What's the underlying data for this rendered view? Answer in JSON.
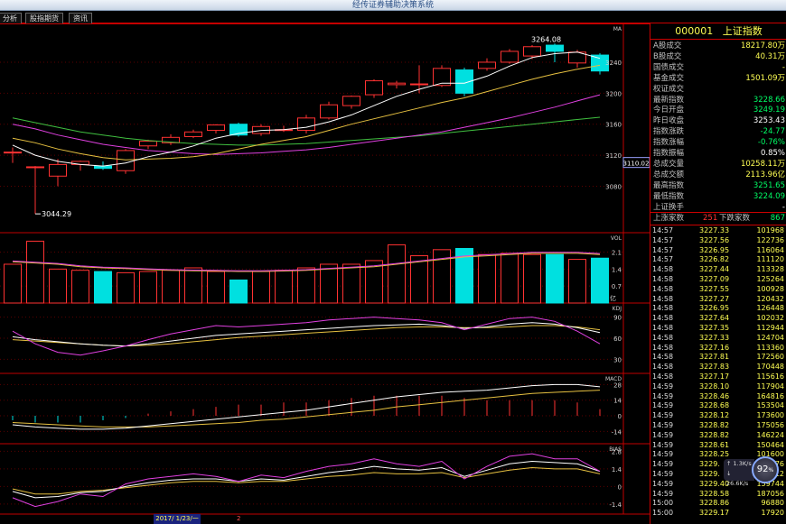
{
  "window": {
    "title": "经传证券辅助决策系统"
  },
  "tabs": [
    {
      "label": "分析"
    },
    {
      "label": "股指期货"
    },
    {
      "label": "资讯"
    }
  ],
  "colors": {
    "up": "#ff3232",
    "down": "#00e0e0",
    "price": "#ffff54",
    "ma5": "#ffffff",
    "ma10": "#e6c040",
    "ma20": "#e040e0",
    "ma60": "#40c040",
    "grid": "#c00000"
  },
  "main_chart": {
    "label_tr": "MA",
    "y_ticks": [
      "3240",
      "3200",
      "3160",
      "3120",
      "3080"
    ],
    "current_price_box": "3110.02",
    "annot_high": "3264.08",
    "annot_low": "3044.29"
  },
  "volume_panel": {
    "label": "VOL",
    "y_ticks": [
      "2.1",
      "1.4",
      "0.7"
    ],
    "unit": "亿"
  },
  "kdj_panel": {
    "label": "KDJ",
    "y_ticks": [
      "90",
      "60",
      "30"
    ]
  },
  "macd_panel": {
    "label": "MACD",
    "y_ticks": [
      "28",
      "14",
      "0",
      "-14"
    ]
  },
  "bias_panel": {
    "label": "BIAS",
    "y_ticks": [
      "2.8",
      "1.4",
      "0",
      "-1.4"
    ]
  },
  "bottom": {
    "date": "2017/ 1/23/一",
    "page": "2"
  },
  "chart_data": {
    "type": "candlestick",
    "candles": [
      {
        "o": 3123,
        "h": 3130,
        "l": 3110,
        "c": 3124
      },
      {
        "o": 3105,
        "h": 3106,
        "l": 3044.29,
        "c": 3105
      },
      {
        "o": 3093,
        "h": 3115,
        "l": 3080,
        "c": 3108
      },
      {
        "o": 3108,
        "h": 3113,
        "l": 3100,
        "c": 3112
      },
      {
        "o": 3106,
        "h": 3112,
        "l": 3101,
        "c": 3103
      },
      {
        "o": 3100,
        "h": 3128,
        "l": 3096,
        "c": 3126
      },
      {
        "o": 3132,
        "h": 3140,
        "l": 3128,
        "c": 3138
      },
      {
        "o": 3136,
        "h": 3147,
        "l": 3133,
        "c": 3143
      },
      {
        "o": 3144,
        "h": 3153,
        "l": 3142,
        "c": 3150
      },
      {
        "o": 3152,
        "h": 3160,
        "l": 3148,
        "c": 3159
      },
      {
        "o": 3160,
        "h": 3162,
        "l": 3144,
        "c": 3146
      },
      {
        "o": 3148,
        "h": 3160,
        "l": 3145,
        "c": 3157
      },
      {
        "o": 3153,
        "h": 3158,
        "l": 3150,
        "c": 3153
      },
      {
        "o": 3152,
        "h": 3172,
        "l": 3148,
        "c": 3168
      },
      {
        "o": 3168,
        "h": 3189,
        "l": 3166,
        "c": 3185
      },
      {
        "o": 3184,
        "h": 3197,
        "l": 3180,
        "c": 3196
      },
      {
        "o": 3198,
        "h": 3218,
        "l": 3194,
        "c": 3216
      },
      {
        "o": 3211,
        "h": 3216,
        "l": 3206,
        "c": 3213
      },
      {
        "o": 3212,
        "h": 3236,
        "l": 3200,
        "c": 3212
      },
      {
        "o": 3210,
        "h": 3236,
        "l": 3208,
        "c": 3232
      },
      {
        "o": 3230,
        "h": 3233,
        "l": 3196,
        "c": 3200
      },
      {
        "o": 3232,
        "h": 3245,
        "l": 3229,
        "c": 3240
      },
      {
        "o": 3240,
        "h": 3257,
        "l": 3238,
        "c": 3254
      },
      {
        "o": 3248,
        "h": 3262,
        "l": 3244,
        "c": 3260
      },
      {
        "o": 3262,
        "h": 3264.08,
        "l": 3240,
        "c": 3254
      },
      {
        "o": 3239,
        "h": 3256,
        "l": 3233,
        "c": 3253
      },
      {
        "o": 3249.19,
        "h": 3251.65,
        "l": 3224.09,
        "c": 3228.66
      }
    ],
    "ma5": [
      3133,
      3120,
      3112,
      3108,
      3106,
      3110,
      3118,
      3124,
      3132,
      3142,
      3148,
      3152,
      3153,
      3156,
      3163,
      3172,
      3184,
      3196,
      3205,
      3213,
      3213,
      3222,
      3235,
      3246,
      3251,
      3253,
      3245
    ],
    "ma10": [
      3142,
      3136,
      3128,
      3122,
      3117,
      3114,
      3115,
      3116,
      3118,
      3122,
      3128,
      3134,
      3139,
      3144,
      3152,
      3160,
      3167,
      3174,
      3181,
      3188,
      3194,
      3202,
      3210,
      3218,
      3225,
      3231,
      3236
    ],
    "ma20": [
      3160,
      3154,
      3146,
      3140,
      3134,
      3130,
      3126,
      3124,
      3122,
      3121,
      3122,
      3123,
      3125,
      3127,
      3130,
      3134,
      3138,
      3142,
      3146,
      3150,
      3156,
      3162,
      3168,
      3175,
      3182,
      3190,
      3198
    ],
    "ma60": [
      3168,
      3162,
      3156,
      3150,
      3146,
      3142,
      3139,
      3137,
      3135,
      3134,
      3133,
      3133,
      3134,
      3135,
      3137,
      3139,
      3141,
      3143,
      3145,
      3148,
      3151,
      3154,
      3157,
      3160,
      3163,
      3166,
      3169
    ],
    "volume": [
      1.6,
      2.55,
      1.4,
      1.35,
      1.3,
      1.25,
      1.3,
      1.35,
      1.45,
      1.3,
      0.95,
      1.3,
      1.35,
      1.45,
      1.6,
      1.6,
      1.75,
      2.4,
      1.95,
      2.2,
      2.25,
      2.0,
      2.05,
      2.0,
      2.0,
      1.8,
      1.85
    ],
    "vol_ma": [
      1.7,
      1.65,
      1.6,
      1.5,
      1.45,
      1.42,
      1.38,
      1.35,
      1.33,
      1.32,
      1.3,
      1.3,
      1.32,
      1.35,
      1.4,
      1.45,
      1.5,
      1.6,
      1.7,
      1.8,
      1.9,
      1.95,
      2.0,
      2.05,
      2.05,
      2.05,
      2.0
    ],
    "kdj_k": [
      62,
      58,
      55,
      52,
      50,
      49,
      52,
      56,
      60,
      64,
      66,
      68,
      70,
      72,
      74,
      76,
      78,
      79,
      80,
      78,
      74,
      76,
      80,
      82,
      80,
      75,
      68
    ],
    "kdj_d": [
      58,
      56,
      54,
      52,
      50,
      49,
      50,
      52,
      55,
      58,
      61,
      63,
      65,
      67,
      69,
      71,
      73,
      75,
      76,
      76,
      75,
      75,
      76,
      78,
      78,
      76,
      72
    ],
    "kdj_j": [
      70,
      52,
      40,
      36,
      42,
      49,
      58,
      66,
      72,
      78,
      76,
      78,
      80,
      82,
      86,
      88,
      90,
      88,
      86,
      82,
      72,
      80,
      88,
      90,
      84,
      70,
      52
    ],
    "macd_dif": [
      -8,
      -10,
      -11,
      -12,
      -12,
      -11,
      -9,
      -7,
      -5,
      -3,
      -1,
      1,
      3,
      5,
      8,
      11,
      14,
      17,
      19,
      21,
      22,
      23,
      25,
      27,
      28,
      28,
      26
    ],
    "macd_dea": [
      -6,
      -7,
      -8,
      -9,
      -10,
      -10,
      -10,
      -9,
      -8,
      -7,
      -6,
      -4,
      -3,
      -1,
      1,
      3,
      5,
      8,
      10,
      12,
      14,
      16,
      18,
      20,
      21,
      22,
      23
    ],
    "bias1": [
      -0.9,
      -1.6,
      -1.2,
      -0.6,
      -0.8,
      0.2,
      0.6,
      0.8,
      1.0,
      0.8,
      0.4,
      0.9,
      0.7,
      1.2,
      1.6,
      1.8,
      2.2,
      1.8,
      1.6,
      2.0,
      0.6,
      1.6,
      2.4,
      2.6,
      2.2,
      2.2,
      1.2
    ],
    "bias2": [
      -0.4,
      -0.9,
      -0.8,
      -0.5,
      -0.4,
      0.0,
      0.3,
      0.5,
      0.6,
      0.6,
      0.4,
      0.6,
      0.5,
      0.8,
      1.1,
      1.3,
      1.6,
      1.4,
      1.3,
      1.5,
      0.8,
      1.3,
      1.8,
      2.0,
      1.9,
      1.8,
      1.2
    ],
    "bias3": [
      -0.2,
      -0.6,
      -0.6,
      -0.4,
      -0.3,
      -0.1,
      0.1,
      0.3,
      0.4,
      0.4,
      0.3,
      0.4,
      0.4,
      0.6,
      0.8,
      0.9,
      1.1,
      1.0,
      1.0,
      1.1,
      0.7,
      1.0,
      1.3,
      1.5,
      1.4,
      1.4,
      1.0
    ]
  },
  "quote": {
    "header_code": "000001",
    "header_name": "上证指数",
    "rows": [
      {
        "label": "A股成交",
        "value": "18217.80万",
        "color": "#ffff54"
      },
      {
        "label": "B股成交",
        "value": "40.31万",
        "color": "#ffff54"
      },
      {
        "label": "国债成交",
        "value": "-",
        "color": "#ffff54"
      },
      {
        "label": "基金成交",
        "value": "1501.09万",
        "color": "#ffff54"
      },
      {
        "label": "权证成交",
        "value": "",
        "color": "#ffff54"
      },
      {
        "label": "最新指数",
        "value": "3228.66",
        "color": "#00ff66"
      },
      {
        "label": "今日开盘",
        "value": "3249.19",
        "color": "#00ff66"
      },
      {
        "label": "昨日收盘",
        "value": "3253.43",
        "color": "#ffffff"
      },
      {
        "label": "指数涨跌",
        "value": "-24.77",
        "color": "#00ff66"
      },
      {
        "label": "指数涨幅",
        "value": "-0.76%",
        "color": "#00ff66"
      },
      {
        "label": "指数振幅",
        "value": "0.85%",
        "color": "#ffffff"
      },
      {
        "label": "总成交量",
        "value": "10258.11万",
        "color": "#ffff54"
      },
      {
        "label": "总成交额",
        "value": "2113.96亿",
        "color": "#ffff54"
      },
      {
        "label": "最高指数",
        "value": "3251.65",
        "color": "#00ff66"
      },
      {
        "label": "最低指数",
        "value": "3224.09",
        "color": "#00ff66"
      },
      {
        "label": "上证换手",
        "value": "-",
        "color": "#ffffff"
      }
    ],
    "updown": {
      "up_label": "上涨家数",
      "up_value": "251",
      "down_label": "下跌家数",
      "down_value": "867"
    }
  },
  "ticks": [
    {
      "time": "14:57",
      "price": "3227.33",
      "vol": "101968"
    },
    {
      "time": "14:57",
      "price": "3227.56",
      "vol": "122736"
    },
    {
      "time": "14:57",
      "price": "3226.95",
      "vol": "116064"
    },
    {
      "time": "14:57",
      "price": "3226.82",
      "vol": "111120"
    },
    {
      "time": "14:58",
      "price": "3227.44",
      "vol": "113328"
    },
    {
      "time": "14:58",
      "price": "3227.09",
      "vol": "125264"
    },
    {
      "time": "14:58",
      "price": "3227.55",
      "vol": "100928"
    },
    {
      "time": "14:58",
      "price": "3227.27",
      "vol": "120432"
    },
    {
      "time": "14:58",
      "price": "3226.95",
      "vol": "126448"
    },
    {
      "time": "14:58",
      "price": "3227.64",
      "vol": "102032"
    },
    {
      "time": "14:58",
      "price": "3227.35",
      "vol": "112944"
    },
    {
      "time": "14:58",
      "price": "3227.33",
      "vol": "124704"
    },
    {
      "time": "14:58",
      "price": "3227.16",
      "vol": "113360"
    },
    {
      "time": "14:58",
      "price": "3227.81",
      "vol": "172560"
    },
    {
      "time": "14:58",
      "price": "3227.83",
      "vol": "170448"
    },
    {
      "time": "14:58",
      "price": "3227.17",
      "vol": "115616"
    },
    {
      "time": "14:59",
      "price": "3228.10",
      "vol": "117904"
    },
    {
      "time": "14:59",
      "price": "3228.46",
      "vol": "164816"
    },
    {
      "time": "14:59",
      "price": "3228.68",
      "vol": "153504"
    },
    {
      "time": "14:59",
      "price": "3228.12",
      "vol": "173600"
    },
    {
      "time": "14:59",
      "price": "3228.82",
      "vol": "175056"
    },
    {
      "time": "14:59",
      "price": "3228.82",
      "vol": "146224"
    },
    {
      "time": "14:59",
      "price": "3228.61",
      "vol": "150464"
    },
    {
      "time": "14:59",
      "price": "3228.25",
      "vol": "101600"
    },
    {
      "time": "14:59",
      "price": "3229.",
      "vol": "105376"
    },
    {
      "time": "14:59",
      "price": "3229.",
      "vol": "147312"
    },
    {
      "time": "14:59",
      "price": "3229.40",
      "vol": "159744"
    },
    {
      "time": "14:59",
      "price": "3228.58",
      "vol": "187056"
    },
    {
      "time": "15:00",
      "price": "3228.86",
      "vol": "96880"
    },
    {
      "time": "15:00",
      "price": "3229.17",
      "vol": "17920"
    }
  ],
  "speed_widget": {
    "percent": "92",
    "rate_up": "1.3K/s",
    "rate_down": "26.6K/s"
  }
}
